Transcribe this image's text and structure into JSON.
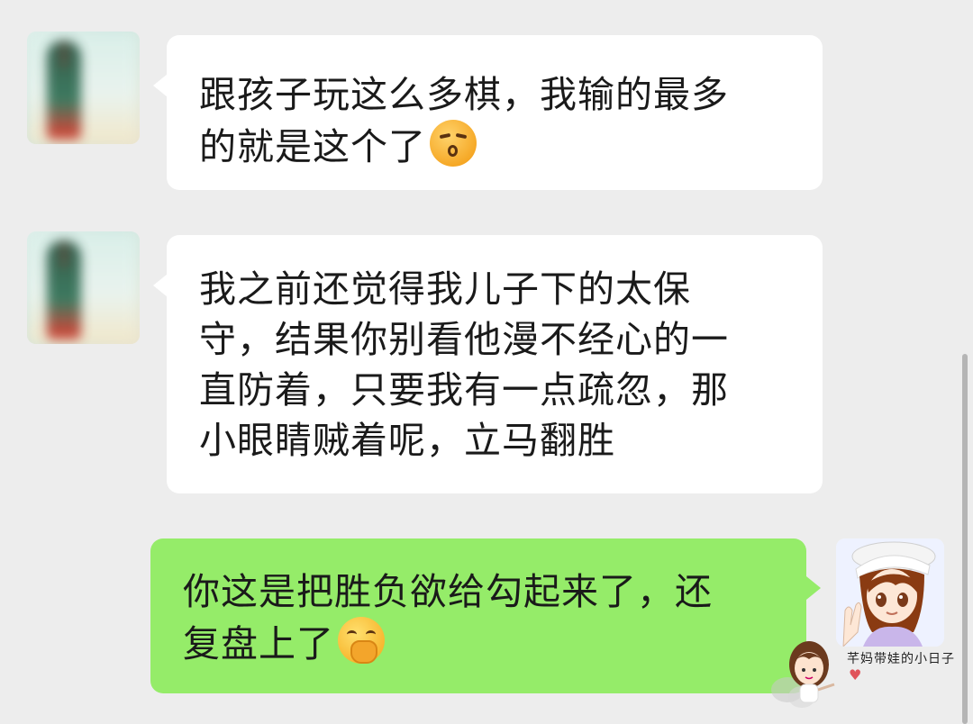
{
  "messages": [
    {
      "sender": "other",
      "text": "跟孩子玩这么多棋，我输的最多的就是这个了",
      "line1": "跟孩子玩这么多棋，我输的最多",
      "line2": "的就是这个了",
      "emoji": "kissing-face-emoji"
    },
    {
      "sender": "other",
      "text": "我之前还觉得我儿子下的太保守，结果你别看他漫不经心的一直防着，只要我有一点疏忽，那小眼睛贼着呢，立马翻胜",
      "line1": "我之前还觉得我儿子下的太保",
      "line2": "守，结果你别看他漫不经心的一",
      "line3": "直防着，只要我有一点疏忽，那",
      "line4": "小眼睛贼着呢，立马翻胜"
    },
    {
      "sender": "self",
      "text": "你这是把胜负欲给勾起来了，还复盘上了",
      "line1": "你这是把胜负欲给勾起来了，还",
      "line2": "复盘上了",
      "emoji": "face-with-hand-over-mouth-emoji"
    }
  ],
  "watermark": {
    "text": "芊妈带娃的小日子"
  },
  "colors": {
    "background": "#ededed",
    "incoming_bubble": "#ffffff",
    "outgoing_bubble": "#95ec69"
  }
}
